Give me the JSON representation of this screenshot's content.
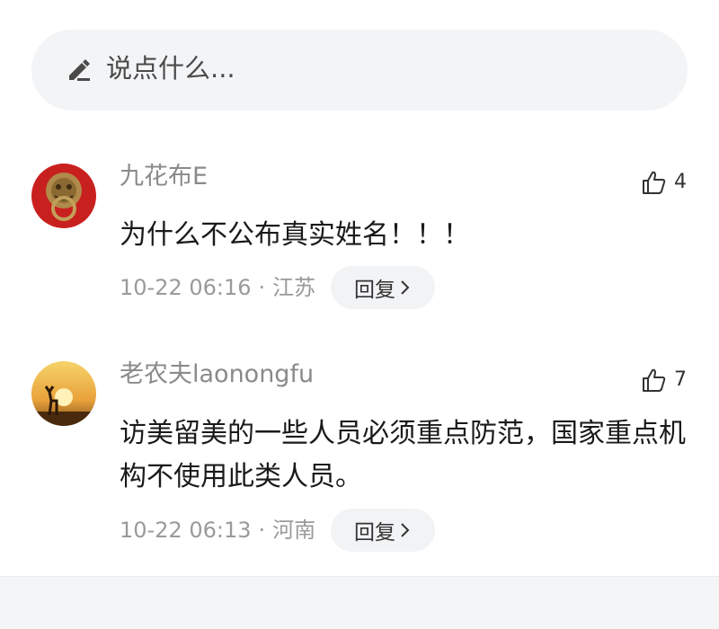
{
  "composer": {
    "placeholder": "说点什么...",
    "icon": "pen-icon"
  },
  "comments": [
    {
      "username": "九花布E",
      "likes": "4",
      "text": "为什么不公布真实姓名！！！",
      "time": "10-22 06:16",
      "separator": "·",
      "location": "江苏",
      "reply_label": "回复",
      "avatar": "door-knocker-avatar"
    },
    {
      "username": "老农夫laonongfu",
      "likes": "7",
      "text": "访美留美的一些人员必须重点防范，国家重点机构不使用此类人员。",
      "time": "10-22 06:13",
      "separator": "·",
      "location": "河南",
      "reply_label": "回复",
      "avatar": "deer-sunset-avatar"
    }
  ],
  "colors": {
    "composer_bg": "#f3f4f6",
    "username": "#8a8a8a",
    "meta": "#9a9a9a",
    "reply_bg": "#f2f3f5"
  }
}
